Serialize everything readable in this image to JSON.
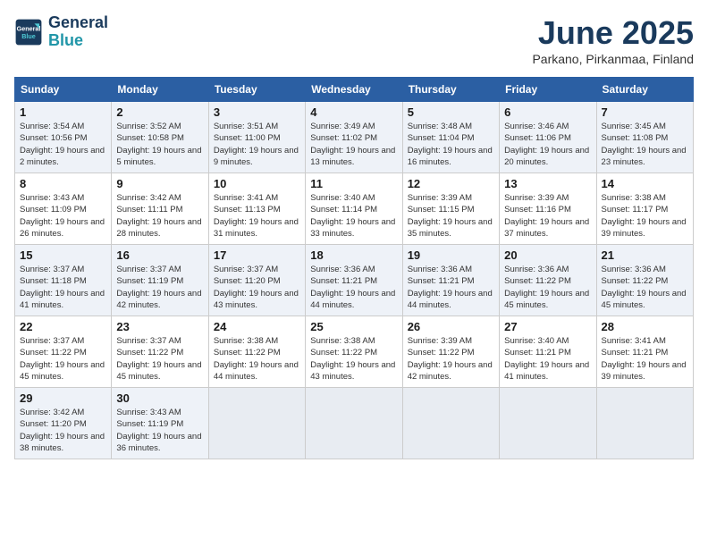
{
  "header": {
    "logo_line1": "General",
    "logo_line2": "Blue",
    "month": "June 2025",
    "location": "Parkano, Pirkanmaa, Finland"
  },
  "weekdays": [
    "Sunday",
    "Monday",
    "Tuesday",
    "Wednesday",
    "Thursday",
    "Friday",
    "Saturday"
  ],
  "weeks": [
    [
      {
        "day": "1",
        "sunrise": "3:54 AM",
        "sunset": "10:56 PM",
        "daylight": "19 hours and 2 minutes."
      },
      {
        "day": "2",
        "sunrise": "3:52 AM",
        "sunset": "10:58 PM",
        "daylight": "19 hours and 5 minutes."
      },
      {
        "day": "3",
        "sunrise": "3:51 AM",
        "sunset": "11:00 PM",
        "daylight": "19 hours and 9 minutes."
      },
      {
        "day": "4",
        "sunrise": "3:49 AM",
        "sunset": "11:02 PM",
        "daylight": "19 hours and 13 minutes."
      },
      {
        "day": "5",
        "sunrise": "3:48 AM",
        "sunset": "11:04 PM",
        "daylight": "19 hours and 16 minutes."
      },
      {
        "day": "6",
        "sunrise": "3:46 AM",
        "sunset": "11:06 PM",
        "daylight": "19 hours and 20 minutes."
      },
      {
        "day": "7",
        "sunrise": "3:45 AM",
        "sunset": "11:08 PM",
        "daylight": "19 hours and 23 minutes."
      }
    ],
    [
      {
        "day": "8",
        "sunrise": "3:43 AM",
        "sunset": "11:09 PM",
        "daylight": "19 hours and 26 minutes."
      },
      {
        "day": "9",
        "sunrise": "3:42 AM",
        "sunset": "11:11 PM",
        "daylight": "19 hours and 28 minutes."
      },
      {
        "day": "10",
        "sunrise": "3:41 AM",
        "sunset": "11:13 PM",
        "daylight": "19 hours and 31 minutes."
      },
      {
        "day": "11",
        "sunrise": "3:40 AM",
        "sunset": "11:14 PM",
        "daylight": "19 hours and 33 minutes."
      },
      {
        "day": "12",
        "sunrise": "3:39 AM",
        "sunset": "11:15 PM",
        "daylight": "19 hours and 35 minutes."
      },
      {
        "day": "13",
        "sunrise": "3:39 AM",
        "sunset": "11:16 PM",
        "daylight": "19 hours and 37 minutes."
      },
      {
        "day": "14",
        "sunrise": "3:38 AM",
        "sunset": "11:17 PM",
        "daylight": "19 hours and 39 minutes."
      }
    ],
    [
      {
        "day": "15",
        "sunrise": "3:37 AM",
        "sunset": "11:18 PM",
        "daylight": "19 hours and 41 minutes."
      },
      {
        "day": "16",
        "sunrise": "3:37 AM",
        "sunset": "11:19 PM",
        "daylight": "19 hours and 42 minutes."
      },
      {
        "day": "17",
        "sunrise": "3:37 AM",
        "sunset": "11:20 PM",
        "daylight": "19 hours and 43 minutes."
      },
      {
        "day": "18",
        "sunrise": "3:36 AM",
        "sunset": "11:21 PM",
        "daylight": "19 hours and 44 minutes."
      },
      {
        "day": "19",
        "sunrise": "3:36 AM",
        "sunset": "11:21 PM",
        "daylight": "19 hours and 44 minutes."
      },
      {
        "day": "20",
        "sunrise": "3:36 AM",
        "sunset": "11:22 PM",
        "daylight": "19 hours and 45 minutes."
      },
      {
        "day": "21",
        "sunrise": "3:36 AM",
        "sunset": "11:22 PM",
        "daylight": "19 hours and 45 minutes."
      }
    ],
    [
      {
        "day": "22",
        "sunrise": "3:37 AM",
        "sunset": "11:22 PM",
        "daylight": "19 hours and 45 minutes."
      },
      {
        "day": "23",
        "sunrise": "3:37 AM",
        "sunset": "11:22 PM",
        "daylight": "19 hours and 45 minutes."
      },
      {
        "day": "24",
        "sunrise": "3:38 AM",
        "sunset": "11:22 PM",
        "daylight": "19 hours and 44 minutes."
      },
      {
        "day": "25",
        "sunrise": "3:38 AM",
        "sunset": "11:22 PM",
        "daylight": "19 hours and 43 minutes."
      },
      {
        "day": "26",
        "sunrise": "3:39 AM",
        "sunset": "11:22 PM",
        "daylight": "19 hours and 42 minutes."
      },
      {
        "day": "27",
        "sunrise": "3:40 AM",
        "sunset": "11:21 PM",
        "daylight": "19 hours and 41 minutes."
      },
      {
        "day": "28",
        "sunrise": "3:41 AM",
        "sunset": "11:21 PM",
        "daylight": "19 hours and 39 minutes."
      }
    ],
    [
      {
        "day": "29",
        "sunrise": "3:42 AM",
        "sunset": "11:20 PM",
        "daylight": "19 hours and 38 minutes."
      },
      {
        "day": "30",
        "sunrise": "3:43 AM",
        "sunset": "11:19 PM",
        "daylight": "19 hours and 36 minutes."
      },
      null,
      null,
      null,
      null,
      null
    ]
  ]
}
